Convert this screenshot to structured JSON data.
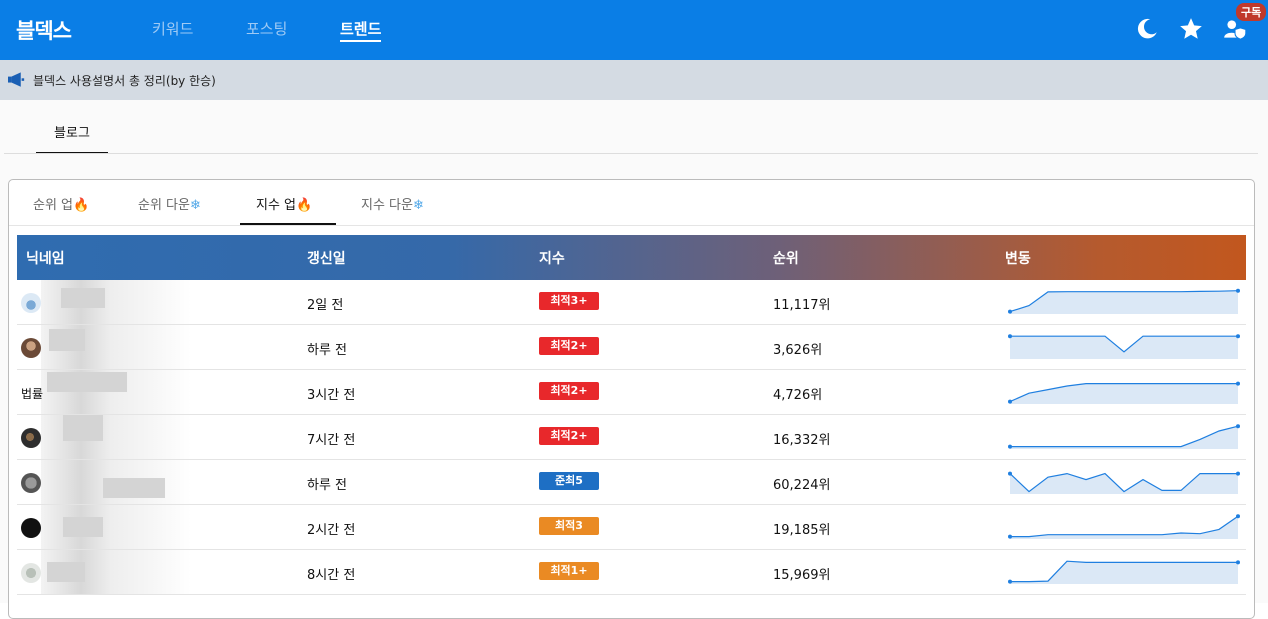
{
  "app": {
    "brand": "블덱스",
    "nav": [
      {
        "label": "키워드",
        "active": false
      },
      {
        "label": "포스팅",
        "active": false
      },
      {
        "label": "트렌드",
        "active": true
      }
    ],
    "subscribe_badge": "구독",
    "icons": [
      "moon-icon",
      "star-icon",
      "user-shield-icon"
    ]
  },
  "notice": {
    "icon": "megaphone-icon",
    "text": "블덱스 사용설명서 총 정리(by 한승)"
  },
  "section_tab": "블로그",
  "subtabs": [
    {
      "label": "순위 업",
      "emoji": "🔥",
      "active": false
    },
    {
      "label": "순위 다운",
      "emoji": "❄",
      "active": false
    },
    {
      "label": "지수 업",
      "emoji": "🔥",
      "active": true
    },
    {
      "label": "지수 다운",
      "emoji": "❄",
      "active": false
    }
  ],
  "table": {
    "headers": [
      "닉네임",
      "갱신일",
      "지수",
      "순위",
      "변동"
    ],
    "rows": [
      {
        "nickname": "",
        "updated": "2일 전",
        "index": "최적3+",
        "index_color": "#e8282b",
        "rank": "11,117위",
        "trend": [
          0.1,
          0.35,
          0.92,
          0.93,
          0.93,
          0.93,
          0.93,
          0.93,
          0.93,
          0.93,
          0.94,
          0.95,
          0.97
        ]
      },
      {
        "nickname": "",
        "updated": "하루 전",
        "index": "최적2+",
        "index_color": "#e8282b",
        "rank": "3,626위",
        "trend": [
          0.95,
          0.95,
          0.95,
          0.95,
          0.95,
          0.95,
          0.3,
          0.95,
          0.95,
          0.95,
          0.95,
          0.95,
          0.95
        ]
      },
      {
        "nickname": "법률",
        "updated": "3시간 전",
        "index": "최적2+",
        "index_color": "#e8282b",
        "rank": "4,726위",
        "trend": [
          0.1,
          0.45,
          0.6,
          0.75,
          0.85,
          0.85,
          0.85,
          0.85,
          0.85,
          0.85,
          0.85,
          0.85,
          0.85
        ]
      },
      {
        "nickname": "",
        "updated": "7시간 전",
        "index": "최적2+",
        "index_color": "#e8282b",
        "rank": "16,332위",
        "trend": [
          0.1,
          0.1,
          0.1,
          0.1,
          0.1,
          0.1,
          0.1,
          0.1,
          0.1,
          0.1,
          0.4,
          0.75,
          0.95
        ]
      },
      {
        "nickname": "",
        "updated": "하루 전",
        "index": "준최5",
        "index_color": "#1e6fc4",
        "rank": "60,224위",
        "trend": [
          0.85,
          0.1,
          0.7,
          0.85,
          0.6,
          0.85,
          0.1,
          0.6,
          0.15,
          0.15,
          0.85,
          0.85,
          0.85
        ]
      },
      {
        "nickname": "",
        "updated": "2시간 전",
        "index": "최적3",
        "index_color": "#ea8a23",
        "rank": "19,185위",
        "trend": [
          0.1,
          0.1,
          0.18,
          0.18,
          0.18,
          0.18,
          0.18,
          0.18,
          0.18,
          0.25,
          0.22,
          0.4,
          0.95
        ]
      },
      {
        "nickname": "",
        "updated": "8시간 전",
        "index": "최적1+",
        "index_color": "#ea8a23",
        "rank": "15,969위",
        "trend": [
          0.1,
          0.1,
          0.12,
          0.95,
          0.9,
          0.9,
          0.9,
          0.9,
          0.9,
          0.9,
          0.9,
          0.9,
          0.9
        ]
      }
    ]
  }
}
